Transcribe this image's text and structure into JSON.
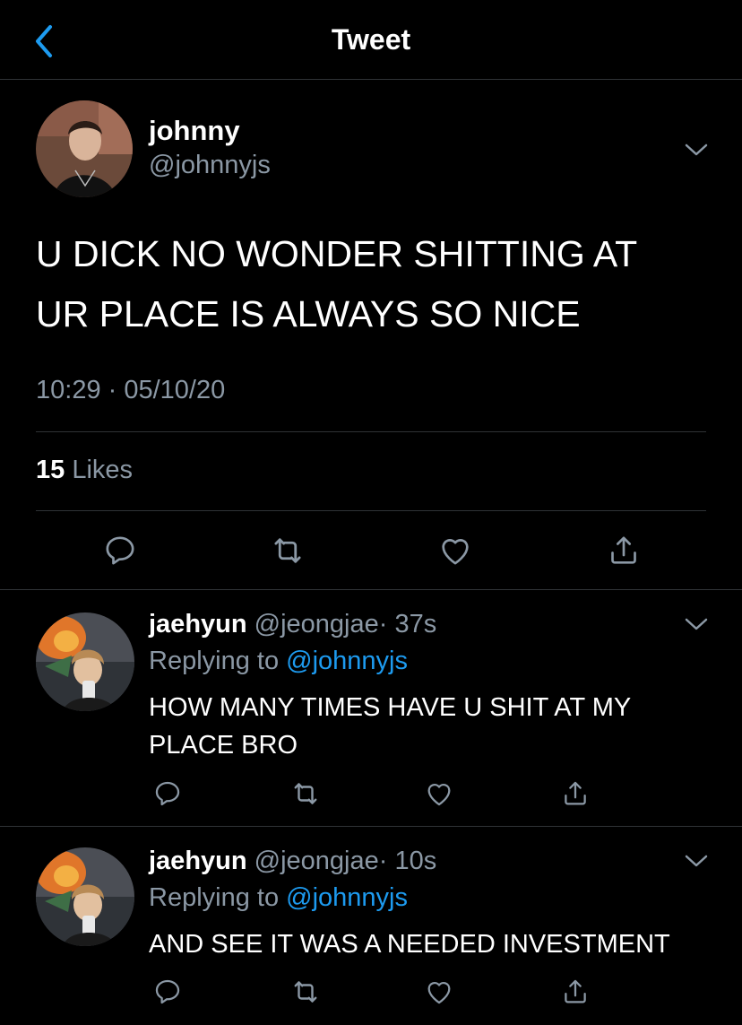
{
  "header": {
    "title": "Tweet",
    "back_icon": "chevron-left-icon"
  },
  "colors": {
    "background": "#000000",
    "text": "#ffffff",
    "secondary": "#8b98a5",
    "link": "#1d9bf0",
    "divider": "#2f3336"
  },
  "main_tweet": {
    "display_name": "johnny",
    "handle": "@johnnyjs",
    "text_line1": "U DICK NO WONDER SHITTING AT",
    "text_line2": "UR PLACE IS ALWAYS SO NICE",
    "timestamp": "10:29 · 05/10/20",
    "likes_count": "15",
    "likes_label": "Likes",
    "actions": [
      "reply-icon",
      "retweet-icon",
      "like-icon",
      "share-icon"
    ]
  },
  "replies": [
    {
      "display_name": "jaehyun",
      "handle": "@jeongjae",
      "time": "· 37s",
      "replying_prefix": "Replying to",
      "replying_to": "@johnnyjs",
      "text": "HOW MANY TIMES HAVE U SHIT AT MY PLACE BRO"
    },
    {
      "display_name": "jaehyun",
      "handle": "@jeongjae",
      "time": "· 10s",
      "replying_prefix": "Replying to",
      "replying_to": "@johnnyjs",
      "text": "AND SEE IT WAS A NEEDED INVESTMENT"
    }
  ]
}
